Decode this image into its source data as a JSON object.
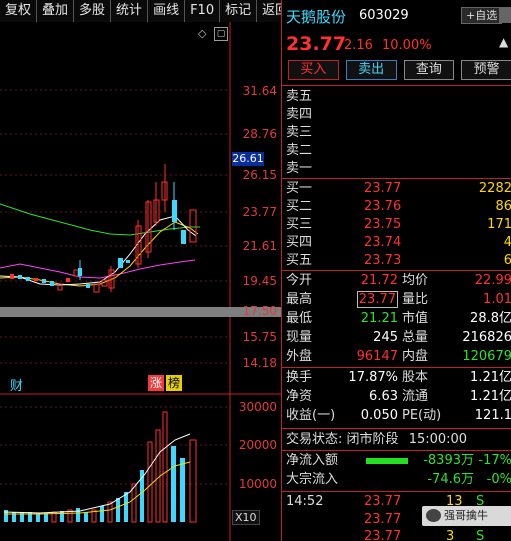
{
  "toolbar": [
    "复权",
    "叠加",
    "多股",
    "统计",
    "画线",
    "F10",
    "标记",
    "返回"
  ],
  "chart": {
    "price_axis": [
      "31.64",
      "28.76",
      "26.15",
      "23.77",
      "21.61",
      "19.45",
      "17.50",
      "15.75",
      "14.18"
    ],
    "current_price_tag": "26.61",
    "volume_axis": [
      "30000",
      "20000",
      "10000"
    ],
    "volume_unit": "X10",
    "tags": {
      "cai": "财",
      "zhang": "涨",
      "bang": "榜"
    },
    "icons": [
      "diamond-icon",
      "zoom-icon"
    ],
    "colors": {
      "up": "#ff3030",
      "down": "#3dd8ff",
      "ma5": "#ffffff",
      "ma10": "#ffd700",
      "ma20": "#ff40ff",
      "ma60": "#30e030"
    }
  },
  "stock": {
    "name": "天鹅股份",
    "code": "603029",
    "watch_label": "+自选",
    "price": "23.77",
    "change": "2.16",
    "change_pct": "10.00%"
  },
  "actions": {
    "buy": "买入",
    "sell": "卖出",
    "query": "查询",
    "alert": "预警"
  },
  "order_book": {
    "asks": [
      {
        "label": "卖五",
        "price": "",
        "vol": ""
      },
      {
        "label": "卖四",
        "price": "",
        "vol": ""
      },
      {
        "label": "卖三",
        "price": "",
        "vol": ""
      },
      {
        "label": "卖二",
        "price": "",
        "vol": ""
      },
      {
        "label": "卖一",
        "price": "",
        "vol": ""
      }
    ],
    "bids": [
      {
        "label": "买一",
        "price": "23.77",
        "vol": "2282"
      },
      {
        "label": "买二",
        "price": "23.76",
        "vol": "86"
      },
      {
        "label": "买三",
        "price": "23.75",
        "vol": "171"
      },
      {
        "label": "买四",
        "price": "23.74",
        "vol": "4"
      },
      {
        "label": "买五",
        "price": "23.73",
        "vol": "6"
      }
    ]
  },
  "quote": [
    {
      "l1": "今开",
      "v1": "21.72",
      "l2": "均价",
      "v2": "22.99"
    },
    {
      "l1": "最高",
      "v1": "23.77",
      "l2": "量比",
      "v2": "1.01"
    },
    {
      "l1": "最低",
      "v1": "21.21",
      "l2": "市值",
      "v2": "28.8亿"
    },
    {
      "l1": "现量",
      "v1": "245",
      "l2": "总量",
      "v2": "216826"
    },
    {
      "l1": "外盘",
      "v1": "96147",
      "l2": "内盘",
      "v2": "120679"
    },
    {
      "l1": "换手",
      "v1": "17.87%",
      "l2": "股本",
      "v2": "1.21亿"
    },
    {
      "l1": "净资",
      "v1": "6.63",
      "l2": "流通",
      "v2": "1.21亿"
    },
    {
      "l1": "收益(一)",
      "v1": "0.050",
      "l2": "PE(动)",
      "v2": "121.1"
    }
  ],
  "trade_status": {
    "label": "交易状态:",
    "phase": "闭市阶段",
    "time": "15:00:00"
  },
  "flows": [
    {
      "label": "净流入额",
      "value": "-8393万",
      "pct": "-17%",
      "bar_fraction": 0.7
    },
    {
      "label": "大宗流入",
      "value": "-74.6万",
      "pct": "-0%",
      "bar_fraction": 0.0
    }
  ],
  "ticks": [
    {
      "time": "14:52",
      "price": "23.77",
      "vol": "13",
      "side": "S"
    },
    {
      "time": "",
      "price": "23.77",
      "vol": "",
      "side": ""
    },
    {
      "time": "",
      "price": "23.77",
      "vol": "3",
      "side": "S"
    }
  ],
  "watermark": "强哥擒牛"
}
